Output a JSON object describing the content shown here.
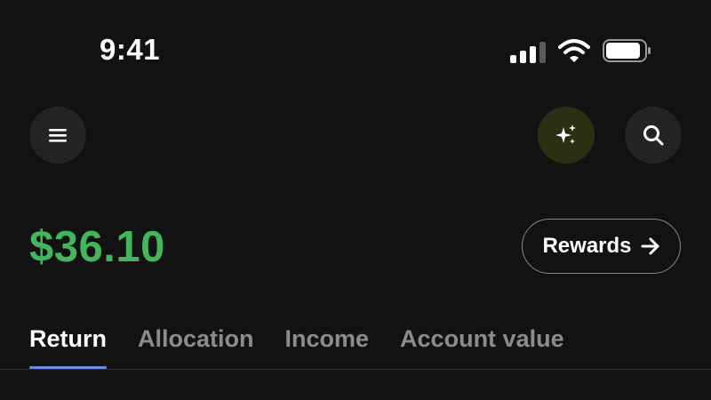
{
  "status_bar": {
    "time": "9:41"
  },
  "header": {
    "menu_icon": "menu-icon",
    "ai_icon": "sparkles-icon",
    "search_icon": "search-icon"
  },
  "portfolio": {
    "balance": "$36.10",
    "rewards_label": "Rewards",
    "balance_color": "#43b65b"
  },
  "tabs": [
    {
      "label": "Return",
      "active": true
    },
    {
      "label": "Allocation",
      "active": false
    },
    {
      "label": "Income",
      "active": false
    },
    {
      "label": "Account value",
      "active": false
    }
  ],
  "colors": {
    "background": "#121212",
    "accent_underline": "#6f8ce8",
    "ai_button_bg": "#2c2f12"
  }
}
